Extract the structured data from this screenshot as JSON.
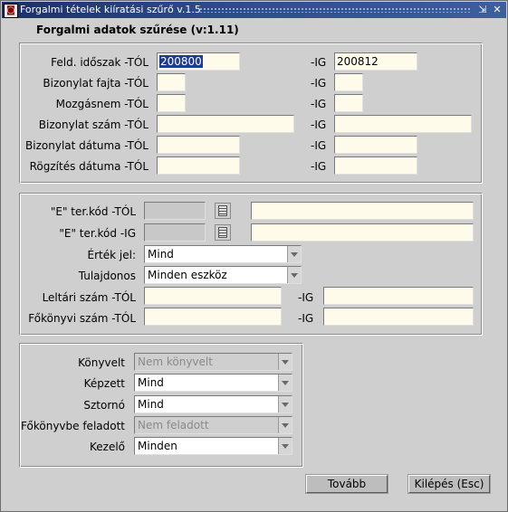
{
  "window": {
    "title": "Forgalmi tételek kiíratási szűrő v.1.5",
    "min_glyph": "⇲",
    "close_glyph": "✕"
  },
  "header": "Forgalmi adatok szűrése (v:1.11)",
  "section1": {
    "rows": [
      {
        "label": "Feld. időszak -TÓL",
        "from": "200800",
        "ig": "-IG",
        "to": "200812"
      },
      {
        "label": "Bizonylat fajta -TÓL",
        "from": "",
        "ig": "-IG",
        "to": ""
      },
      {
        "label": "Mozgásnem -TÓL",
        "from": "",
        "ig": "-IG",
        "to": ""
      },
      {
        "label": "Bizonylat szám -TÓL",
        "from": "",
        "ig": "-IG",
        "to": ""
      },
      {
        "label": "Bizonylat dátuma -TÓL",
        "from": "",
        "ig": "-IG",
        "to": ""
      },
      {
        "label": "Rögzítés dátuma -TÓL",
        "from": "",
        "ig": "-IG",
        "to": ""
      }
    ]
  },
  "section2": {
    "e_tol": {
      "label": "\"E\" ter.kód -TÓL",
      "code": "",
      "desc": ""
    },
    "e_ig": {
      "label": "\"E\" ter.kód -IG",
      "code": "",
      "desc": ""
    },
    "ertek_jel": {
      "label": "Érték jel:",
      "value": "Mind"
    },
    "tulajdonos": {
      "label": "Tulajdonos",
      "value": "Minden eszköz"
    },
    "leltari": {
      "label": "Leltári szám -TÓL",
      "ig": "-IG",
      "from": "",
      "to": ""
    },
    "fokonyvi": {
      "label": "Főkönyvi szám -TÓL",
      "ig": "-IG",
      "from": "",
      "to": ""
    }
  },
  "section3": {
    "konyvelt": {
      "label": "Könyvelt",
      "value": "Nem könyvelt"
    },
    "kepzett": {
      "label": "Képzett",
      "value": "Mind"
    },
    "sztorno": {
      "label": "Sztornó",
      "value": "Mind"
    },
    "fokonyvbe": {
      "label": "Főkönyvbe feladott",
      "value": "Nem feladott"
    },
    "kezelo": {
      "label": "Kezelő",
      "value": "Minden"
    }
  },
  "buttons": {
    "tovabb": "Tovább",
    "kilepes": "Kilépés (Esc)"
  }
}
